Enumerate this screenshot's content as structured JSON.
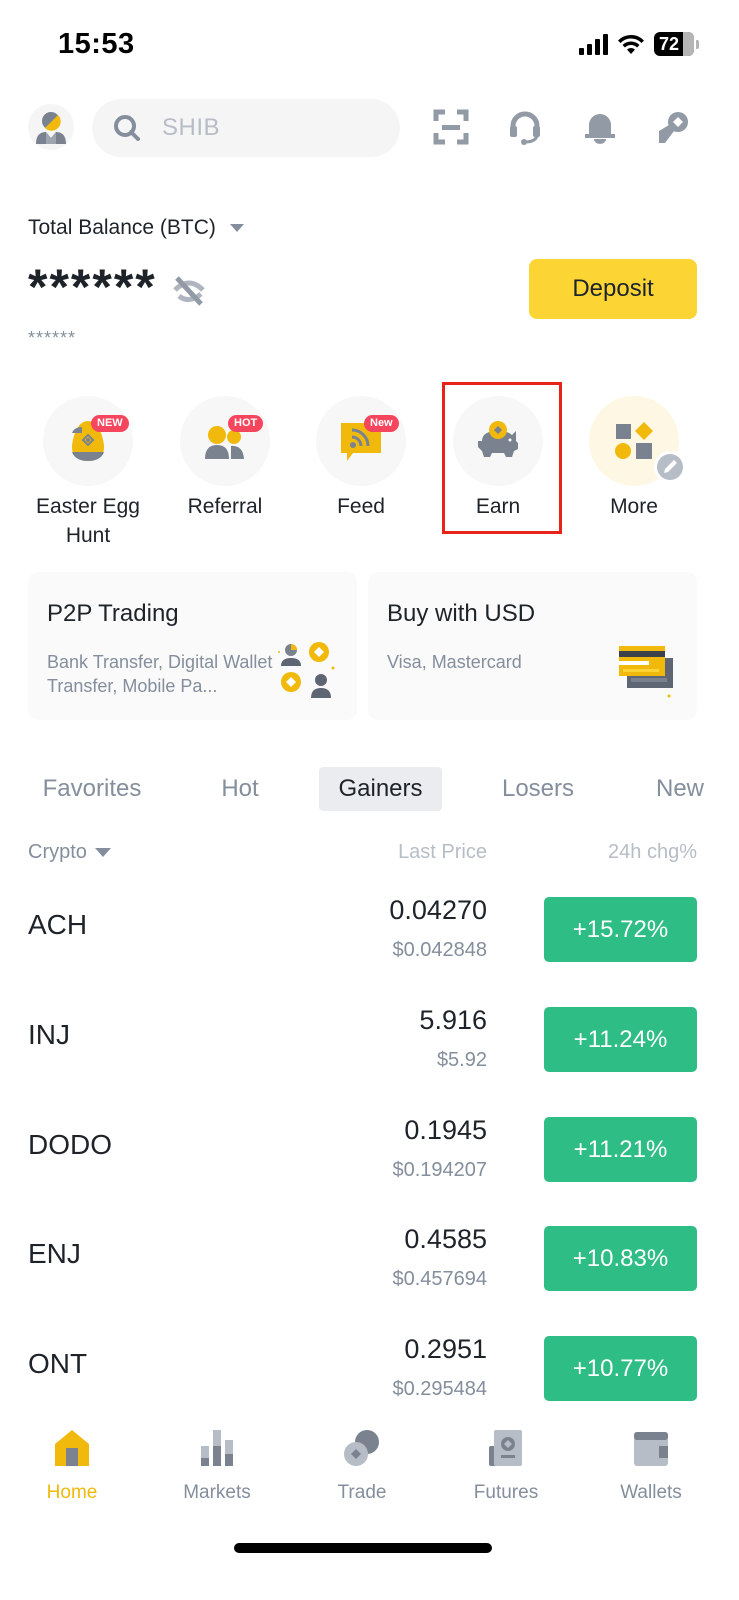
{
  "status_bar": {
    "time": "15:53",
    "battery": "72"
  },
  "header": {
    "search_placeholder": "SHIB",
    "icons": [
      "scan-icon",
      "support-headset-icon",
      "notification-bell-icon",
      "referral-gift-icon"
    ]
  },
  "balance": {
    "label": "Total Balance (BTC)",
    "value": "******",
    "sub_value": "******",
    "deposit_label": "Deposit"
  },
  "shortcuts": [
    {
      "label": "Easter Egg Hunt",
      "badge": "NEW",
      "icon": "easter-egg-icon"
    },
    {
      "label": "Referral",
      "badge": "HOT",
      "icon": "referral-icon"
    },
    {
      "label": "Feed",
      "badge": "New",
      "icon": "feed-icon"
    },
    {
      "label": "Earn",
      "badge": "",
      "icon": "piggy-bank-icon"
    },
    {
      "label": "More",
      "badge": "",
      "icon": "more-apps-icon"
    }
  ],
  "cards": [
    {
      "title": "P2P Trading",
      "subtitle": "Bank Transfer, Digital Wallet Transfer, Mobile Pa..."
    },
    {
      "title": "Buy with USD",
      "subtitle": "Visa, Mastercard"
    }
  ],
  "market": {
    "tabs": [
      "Favorites",
      "Hot",
      "Gainers",
      "Losers",
      "New"
    ],
    "active_tab": "Gainers",
    "columns": {
      "crypto": "Crypto",
      "last_price": "Last Price",
      "change": "24h chg%"
    },
    "rows": [
      {
        "symbol": "ACH",
        "price": "0.04270",
        "usd": "$0.042848",
        "change": "+15.72%"
      },
      {
        "symbol": "INJ",
        "price": "5.916",
        "usd": "$5.92",
        "change": "+11.24%"
      },
      {
        "symbol": "DODO",
        "price": "0.1945",
        "usd": "$0.194207",
        "change": "+11.21%"
      },
      {
        "symbol": "ENJ",
        "price": "0.4585",
        "usd": "$0.457694",
        "change": "+10.83%"
      },
      {
        "symbol": "ONT",
        "price": "0.2951",
        "usd": "$0.295484",
        "change": "+10.77%"
      }
    ]
  },
  "bottom_nav": {
    "items": [
      {
        "label": "Home",
        "active": true
      },
      {
        "label": "Markets",
        "active": false
      },
      {
        "label": "Trade",
        "active": false
      },
      {
        "label": "Futures",
        "active": false
      },
      {
        "label": "Wallets",
        "active": false
      }
    ]
  },
  "colors": {
    "brand_yellow": "#fcd535",
    "accent_gold": "#f0b90b",
    "positive_green": "#2ebd85",
    "badge_red": "#f6465d",
    "highlight_red": "#e8231a",
    "muted_gray": "#848e9c"
  }
}
